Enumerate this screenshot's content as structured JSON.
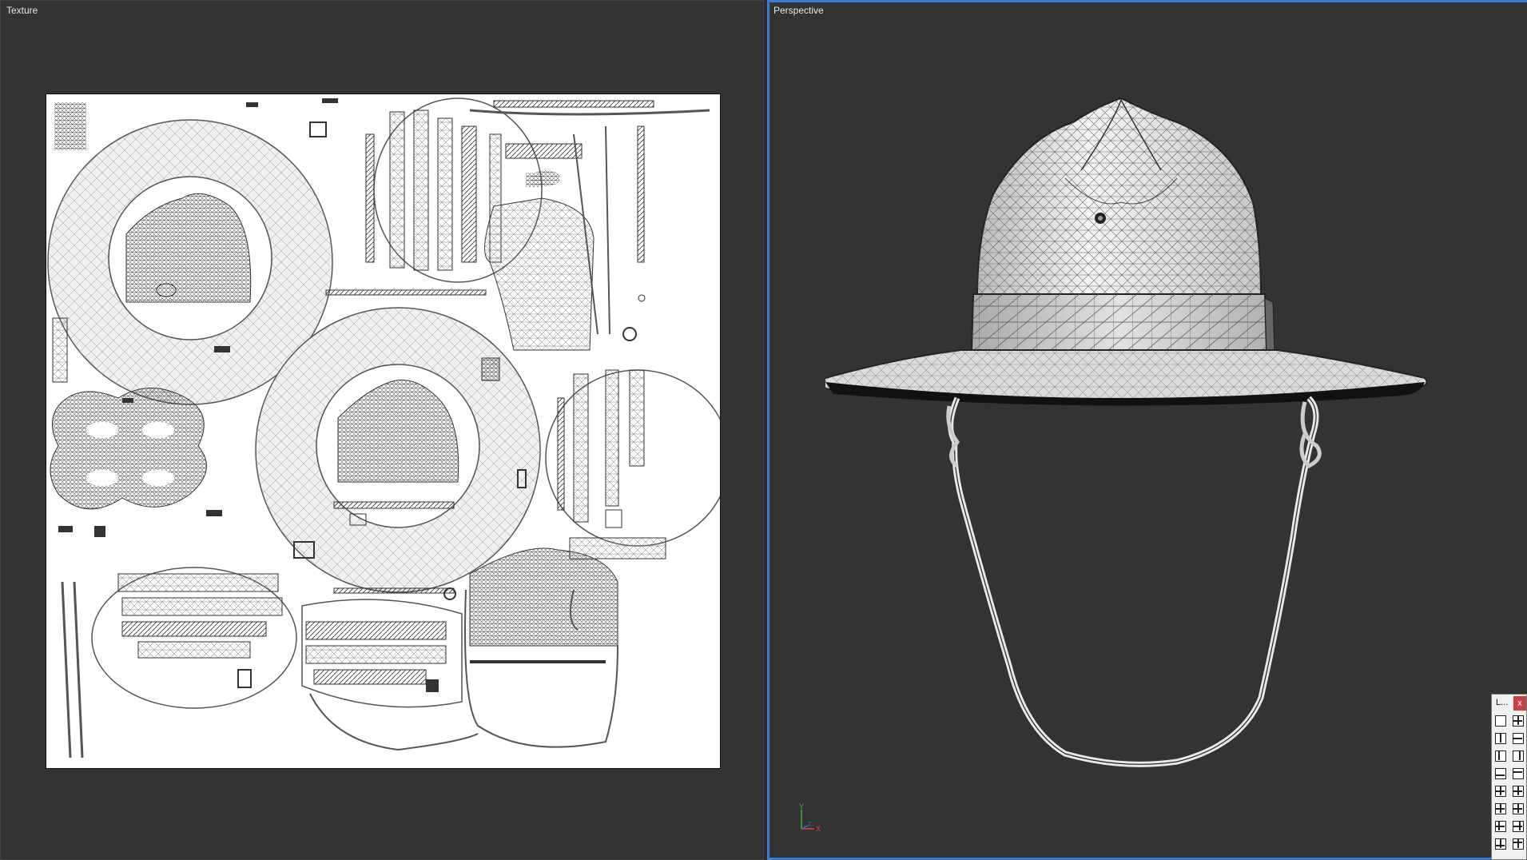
{
  "texture_view": {
    "label": "Texture"
  },
  "perspective_view": {
    "label": "Perspective"
  },
  "axis": {
    "y": "Y",
    "z": "Z",
    "x": "X",
    "x_color": "#d94444",
    "y_color": "#3db43d",
    "z_color": "#3a6fd8"
  },
  "layout_panel": {
    "title": "L...",
    "close": "x",
    "icons": [
      "layout-single-icon",
      "layout-quad-icon",
      "layout-vsplit-icon",
      "layout-hsplit-icon",
      "layout-vsplit-left-icon",
      "layout-vsplit-right-icon",
      "layout-hsplit-bottom-icon",
      "layout-hsplit-top-icon",
      "layout-three-left-icon",
      "layout-three-right-icon",
      "layout-three-bottom-icon",
      "layout-three-top-icon",
      "layout-four-left-icon",
      "layout-four-right-icon",
      "layout-four-bottom-icon",
      "layout-four-top-icon"
    ]
  },
  "colors": {
    "viewport_bg": "#333333",
    "active_border": "#3a7bd5",
    "uv_bg": "#ffffff"
  }
}
